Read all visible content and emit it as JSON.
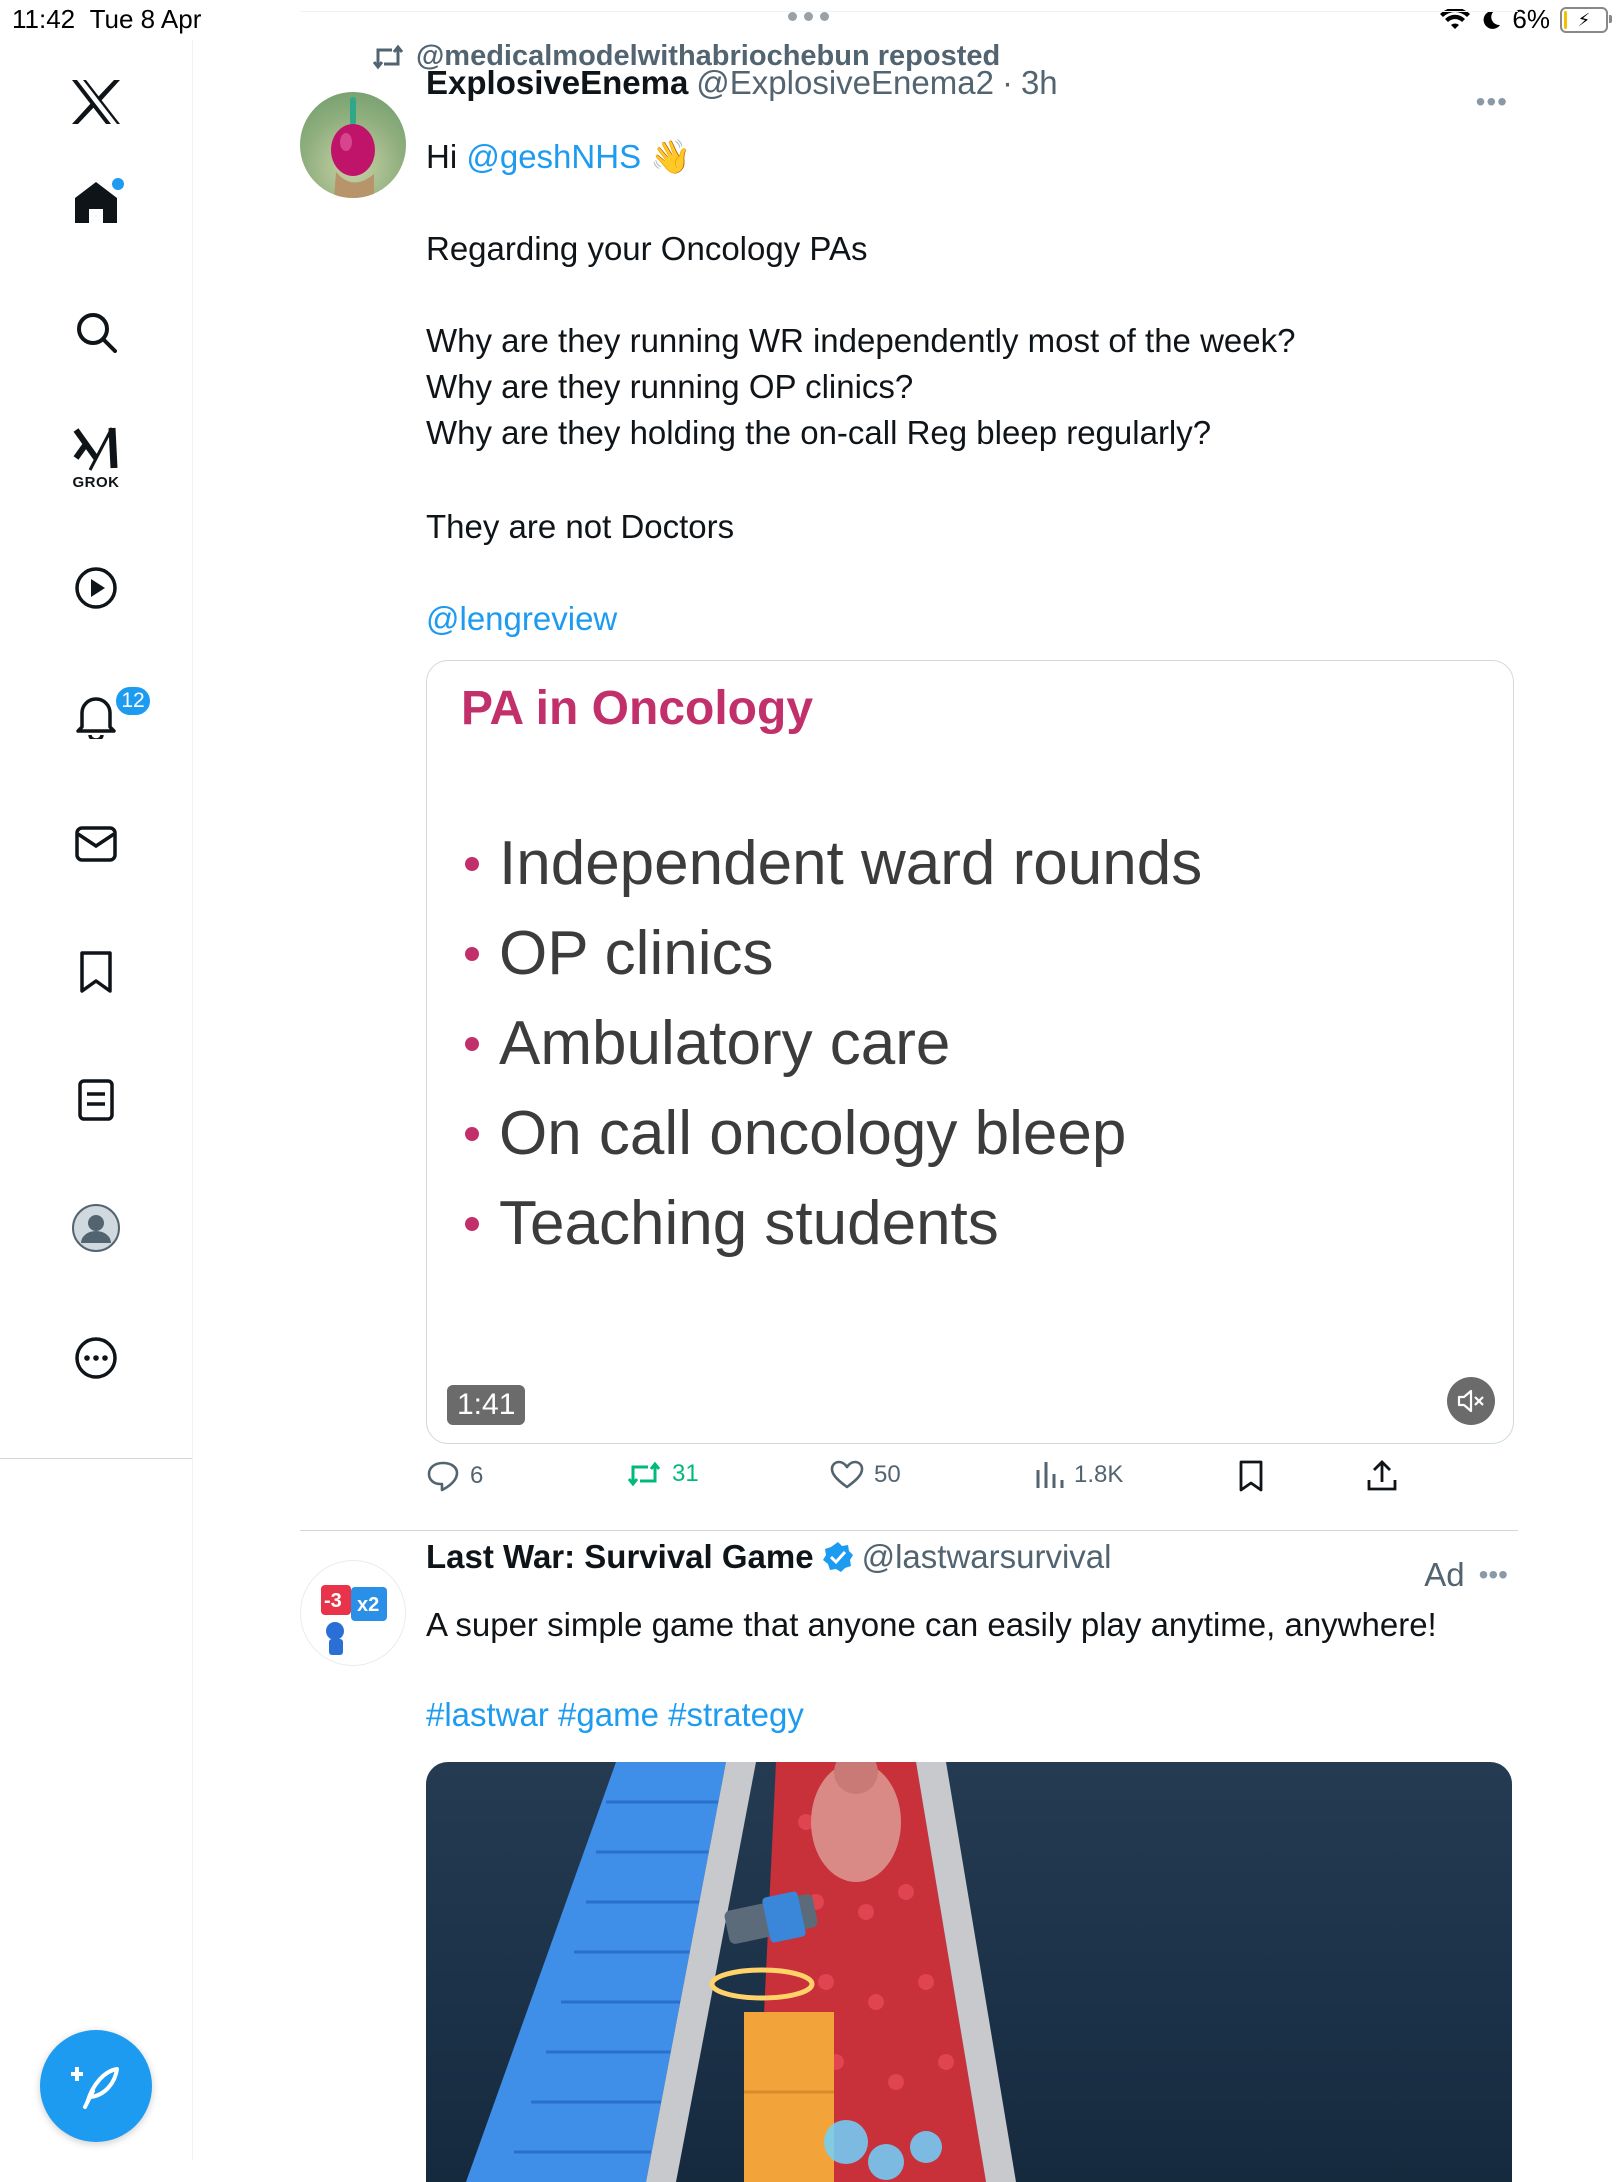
{
  "status_bar": {
    "time": "11:42",
    "date": "Tue 8 Apr",
    "battery": "6%"
  },
  "sidebar": {
    "grok_label": "GROK",
    "notifications_count": "12"
  },
  "colors": {
    "accent": "#1d9bf0",
    "repost_green": "#00ba7c",
    "slide_accent": "#c2306b"
  },
  "posts": [
    {
      "repost_by": "@medicalmodelwithabriochebun reposted",
      "name": "ExplosiveEnema",
      "handle": "@ExplosiveEnema2",
      "time": "3h",
      "greeting": "Hi",
      "mention": "@geshNHS",
      "emoji": "👋",
      "paragraph1": "Regarding your Oncology PAs",
      "questions": "Why are they running WR independently most of the week?\nWhy are they running OP clinics?\nWhy are they holding the on-call Reg bleep regularly?",
      "statement": "They are not Doctors",
      "mention2": "@lengreview",
      "media": {
        "title": "PA in Oncology",
        "items": [
          "Independent ward rounds",
          "OP clinics",
          "Ambulatory care",
          "On call oncology bleep",
          "Teaching students"
        ],
        "duration": "1:41"
      },
      "stats": {
        "replies": "6",
        "reposts": "31",
        "likes": "50",
        "views": "1.8K"
      }
    },
    {
      "name": "Last War: Survival Game",
      "handle": "@lastwarsurvival",
      "ad_label": "Ad",
      "text": "A super simple game that anyone can easily play anytime, anywhere!",
      "hashtags": "#lastwar #game #strategy",
      "avatar_text": "-3 x2"
    }
  ]
}
